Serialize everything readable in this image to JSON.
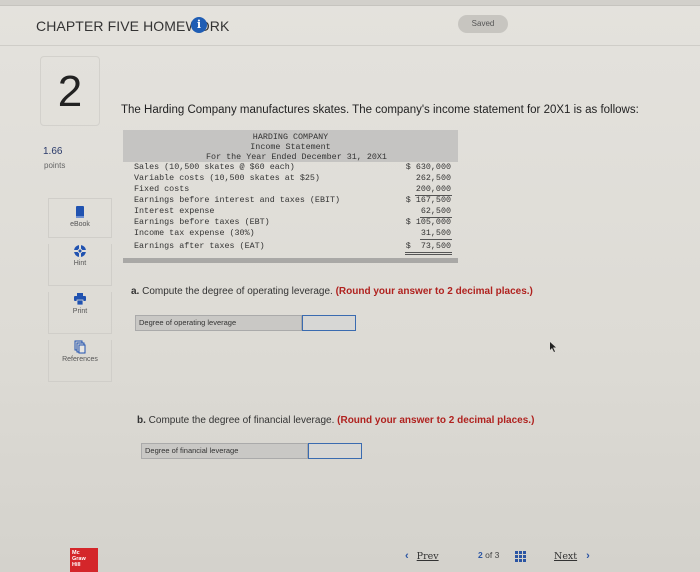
{
  "header": {
    "title": "CHAPTER FIVE HOMEWORK",
    "info_icon": "info-icon",
    "status": "Saved"
  },
  "question": {
    "number": "2",
    "points_value": "1.66",
    "points_label": "points",
    "intro": "The Harding Company manufactures skates. The company's income statement for 20X1 is as follows:"
  },
  "tools": [
    {
      "label": "eBook",
      "icon": "book-icon"
    },
    {
      "label": "Hint",
      "icon": "lifebuoy-icon"
    },
    {
      "label": "Print",
      "icon": "printer-icon"
    },
    {
      "label": "References",
      "icon": "documents-icon"
    }
  ],
  "statement": {
    "company": "HARDING COMPANY",
    "title": "Income Statement",
    "period": "For the Year Ended December 31, 20X1",
    "rows": [
      {
        "label": "Sales (10,500 skates @ $60 each)",
        "amount": "$ 630,000"
      },
      {
        "label": "Variable costs (10,500 skates at $25)",
        "amount": "262,500"
      },
      {
        "label": "Fixed costs",
        "amount": "200,000"
      },
      {
        "label": "Earnings before interest and taxes (EBIT)",
        "amount": "$ 167,500"
      },
      {
        "label": "Interest expense",
        "amount": "62,500"
      },
      {
        "label": "Earnings before taxes (EBT)",
        "amount": "$ 105,000"
      },
      {
        "label": "Income tax expense (30%)",
        "amount": "31,500"
      },
      {
        "label": "Earnings after taxes (EAT)",
        "amount": "$  73,500"
      }
    ]
  },
  "part_a": {
    "prefix": "a.",
    "text": "Compute the degree of operating leverage.",
    "note": "(Round your answer to 2 decimal places.)",
    "answer_label": "Degree of operating leverage",
    "answer_value": ""
  },
  "part_b": {
    "prefix": "b.",
    "text": "Compute the degree of financial leverage.",
    "note": "(Round your answer to 2 decimal places.)",
    "answer_label": "Degree of financial leverage",
    "answer_value": ""
  },
  "footer": {
    "logo_lines": [
      "Mc",
      "Graw",
      "Hill"
    ],
    "prev_label": "Prev",
    "current_page": "2",
    "of_label": "of",
    "total_pages": "3",
    "next_label": "Next"
  },
  "colors": {
    "accent_blue": "#2b55a3",
    "note_red": "#b0221f",
    "logo_red": "#d4262a"
  }
}
